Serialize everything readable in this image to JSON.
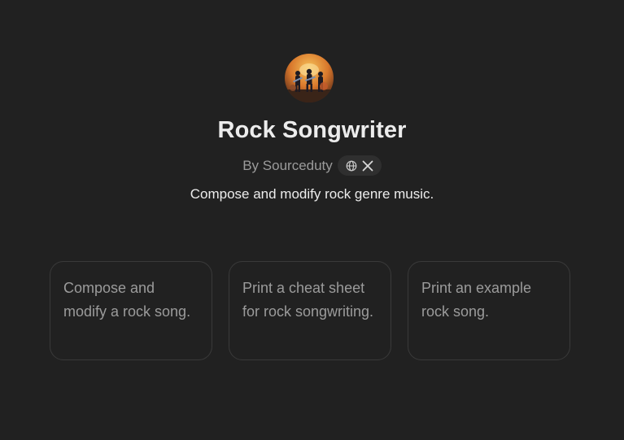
{
  "gpt": {
    "name": "Rock Songwriter",
    "author": "By Sourceduty",
    "description": "Compose and modify rock genre music."
  },
  "social": {
    "icons": [
      "globe-icon",
      "x-logo-icon"
    ]
  },
  "starters": [
    {
      "text": "Compose and modify a rock song."
    },
    {
      "text": "Print a cheat sheet for rock songwriting."
    },
    {
      "text": "Print an example rock song."
    }
  ],
  "colors": {
    "background": "#212121",
    "card_border": "#3a3a3a",
    "muted_text": "#9b9b9b",
    "primary_text": "#ececec",
    "pill_background": "#2f2f2f"
  }
}
